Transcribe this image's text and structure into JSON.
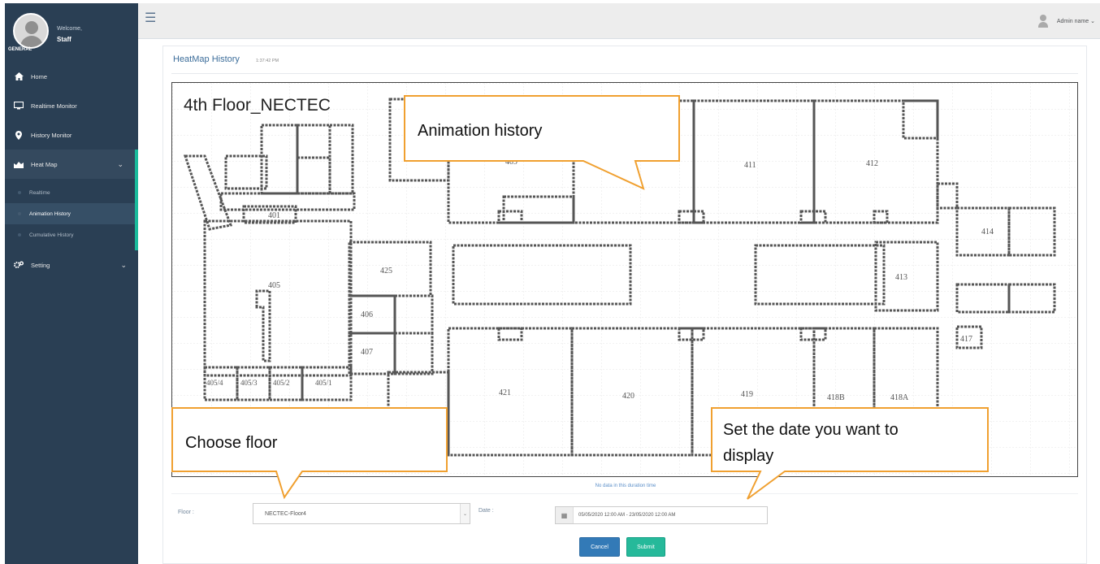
{
  "sidebar": {
    "welcome": "Welcome,",
    "user_name": "Staff",
    "section_label": "GENERAL",
    "items": [
      {
        "label": "Home",
        "icon": "home-icon"
      },
      {
        "label": "Realtime Monitor",
        "icon": "monitor-icon"
      },
      {
        "label": "History Monitor",
        "icon": "map-marker-icon"
      },
      {
        "label": "Heat Map",
        "icon": "area-chart-icon"
      },
      {
        "label": "Setting",
        "icon": "gears-icon"
      }
    ],
    "heatmap_sub": [
      {
        "label": "Realtime"
      },
      {
        "label": "Animation History"
      },
      {
        "label": "Cumulative History"
      }
    ]
  },
  "topbar": {
    "admin_name": "Admin name",
    "admin_caret": "⌄"
  },
  "page": {
    "title": "HeatMap History",
    "time": "1:37:42 PM"
  },
  "map": {
    "title": "4th Floor_NECTEC",
    "rooms": [
      "409",
      "411",
      "412",
      "401",
      "414",
      "425",
      "413",
      "405",
      "406",
      "407",
      "417",
      "421",
      "420",
      "419",
      "418B",
      "418A",
      "405/4",
      "405/3",
      "405/2",
      "405/1"
    ]
  },
  "status": {
    "no_data": "No data in this duration time"
  },
  "form": {
    "floor_label": "Floor :",
    "floor_value": "NECTEC-Floor4",
    "date_label": "Date :",
    "date_value": "05/05/2020 12:00 AM - 23/05/2020 12:00 AM",
    "cancel": "Cancel",
    "submit": "Submit"
  },
  "callouts": {
    "animation": "Animation history",
    "floor": "Choose floor",
    "date_line1": "Set the date you want to",
    "date_line2": "display"
  },
  "colors": {
    "sidebar": "#2a3f54",
    "accent": "#1abb9c",
    "callout_border": "#f0a030",
    "cancel": "#337ab7",
    "submit": "#26b99a"
  }
}
